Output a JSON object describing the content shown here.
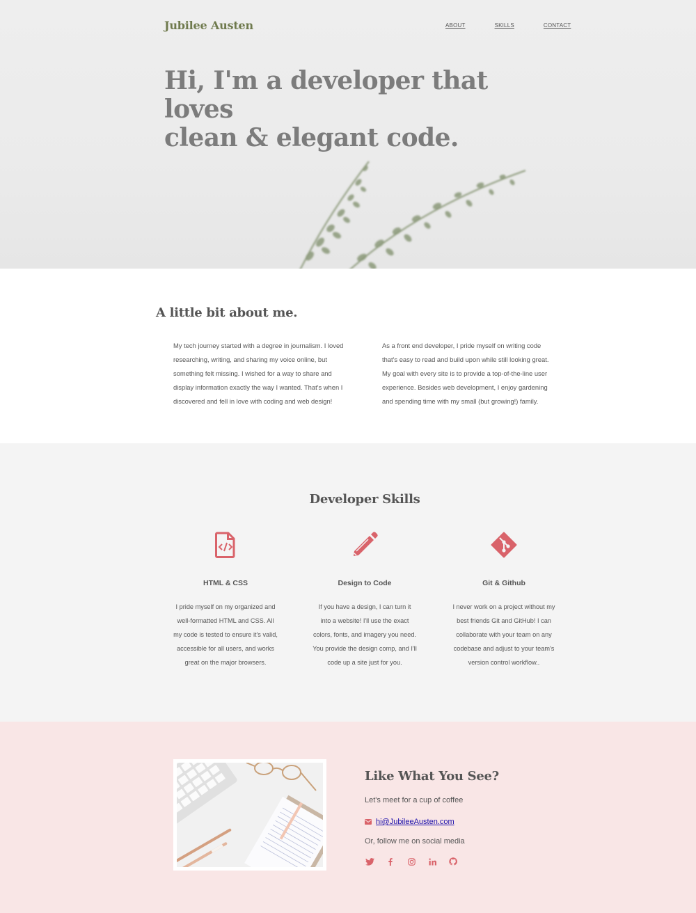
{
  "header": {
    "brand": "Jubilee Austen",
    "nav": [
      "ABOUT",
      "SKILLS",
      "CONTACT"
    ]
  },
  "hero": {
    "headline_line1": "Hi, I'm a developer that loves",
    "headline_line2": "clean & elegant code."
  },
  "about": {
    "title": "A little bit about me.",
    "left": "My tech journey started with a degree in journalism. I loved researching, writing, and sharing my voice online, but something felt missing. I wished for a way to share and display information exactly the way I wanted. That's when I discovered and fell in love with coding and web design!",
    "right": "As a front end developer, I pride myself on writing code that's easy to read and build upon while still looking great. My goal with every site is to provide a top-of-the-line user experience. Besides web development, I enjoy gardening and spending time with my small (but growing!) family."
  },
  "skills": {
    "title": "Developer Skills",
    "items": [
      {
        "icon": "file-code-icon",
        "title": "HTML & CSS",
        "text": "I pride myself on my organized and well-formatted HTML and CSS. All my code is tested to ensure it's valid, accessible for all users, and works great on the major browsers."
      },
      {
        "icon": "pencil-icon",
        "title": "Design to Code",
        "text": "If you have a design, I can turn it into a website! I'll use the exact colors, fonts, and imagery you need. You provide the design comp, and I'll code up a site just for you."
      },
      {
        "icon": "git-icon",
        "title": "Git & Github",
        "text": "I never work on a project without my best friends Git and GitHub! I can collaborate with your team on any codebase and adjust to your team's version control workflow.."
      }
    ]
  },
  "contact": {
    "title": "Like What You See?",
    "meet": "Let's meet for a cup of coffee",
    "email": "hi@JubileeAusten.com",
    "follow": "Or, follow me on social media",
    "social": [
      "twitter-icon",
      "facebook-icon",
      "instagram-icon",
      "linkedin-icon",
      "github-icon"
    ]
  },
  "colors": {
    "brand": "#6f7a4d",
    "accent": "#d9636a",
    "contact_bg": "#f9e6e6",
    "skills_bg": "#f4f4f4"
  }
}
